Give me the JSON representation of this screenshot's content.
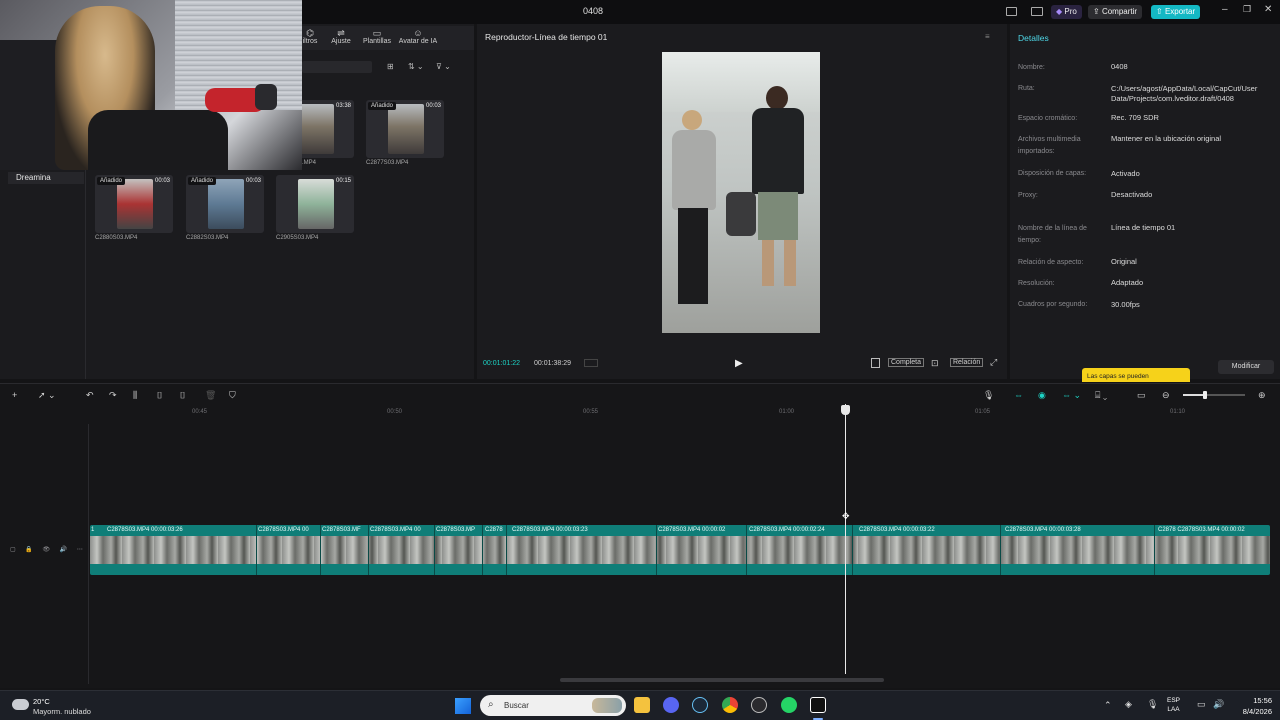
{
  "titlebar": {
    "title": "0408",
    "pro_label": "Pro",
    "share_label": "Compartir",
    "export_label": "Exportar"
  },
  "media": {
    "toolbar": [
      {
        "label": "iltros",
        "icon": "filters-icon"
      },
      {
        "label": "Ajuste",
        "icon": "adjust-icon"
      },
      {
        "label": "Plantillas",
        "icon": "templates-icon"
      },
      {
        "label": "Avatar de IA",
        "icon": "avatar-icon"
      }
    ],
    "sidebar_item": "Dreamina",
    "clips": [
      {
        "badge": "",
        "duration": "03:38",
        "name": ".MP4"
      },
      {
        "badge": "Añadido",
        "duration": "00:03",
        "name": "C2877S03.MP4"
      },
      {
        "badge": "Añadido",
        "duration": "00:03",
        "name": "C2880S03.MP4"
      },
      {
        "badge": "Añadido",
        "duration": "00:03",
        "name": "C2882S03.MP4"
      },
      {
        "badge": "",
        "duration": "00:15",
        "name": "C2905S03.MP4"
      }
    ]
  },
  "player": {
    "title": "Reproductor-Línea de tiempo 01",
    "current_time": "00:01:01:22",
    "total_time": "00:01:38:29",
    "complete_label": "Completa",
    "ratio_label": "Relación"
  },
  "details": {
    "title": "Detalles",
    "rows": [
      {
        "label": "Nombre:",
        "value": "0408"
      },
      {
        "label": "Ruta:",
        "value": "C:/Users/agost/AppData/Local/CapCut/User Data/Projects/com.lveditor.draft/0408"
      },
      {
        "label": "Espacio cromático:",
        "value": "Rec. 709 SDR"
      },
      {
        "label": "Archivos multimedia importados:",
        "value": "Mantener en la ubicación original"
      },
      {
        "label": "Disposición de capas:",
        "value": "Activado"
      },
      {
        "label": "Proxy:",
        "value": "Desactivado"
      },
      {
        "label": "Nombre de la línea de tiempo:",
        "value": "Línea de tiempo 01"
      },
      {
        "label": "Relación de aspecto:",
        "value": "Original"
      },
      {
        "label": "Resolución:",
        "value": "Adaptado"
      },
      {
        "label": "Cuadros por segundo:",
        "value": "30.00fps"
      }
    ],
    "tooltip": "Las capas se pueden",
    "modify_label": "Modificar"
  },
  "timeline": {
    "ruler": [
      "00:45",
      "00:50",
      "00:55",
      "01:00",
      "01:05",
      "01:10"
    ],
    "segments": [
      "1",
      "C2878S03.MP4 00:00:03:26",
      "C2878S03.MP4 00",
      "C2878S03.MF",
      "C2878S03.MP4 00",
      "C2878S03.MP",
      "C2878",
      "C2878S03.MP4 00:00:03:23",
      "C2878S03.MP4 00:00:02",
      "C2878S03.MP4 00:00:02:24",
      "C2878S03.MP4 00:00:03:22",
      "C2878S03.MP4 00:00:03:28",
      "C2878 C2878S03.MP4 00:00:02"
    ]
  },
  "taskbar": {
    "temp": "20°C",
    "weather": "Mayorm. nublado",
    "search": "Buscar",
    "lang_1": "ESP",
    "lang_2": "LAA",
    "time": "15:56",
    "date": "8/4/2026"
  }
}
